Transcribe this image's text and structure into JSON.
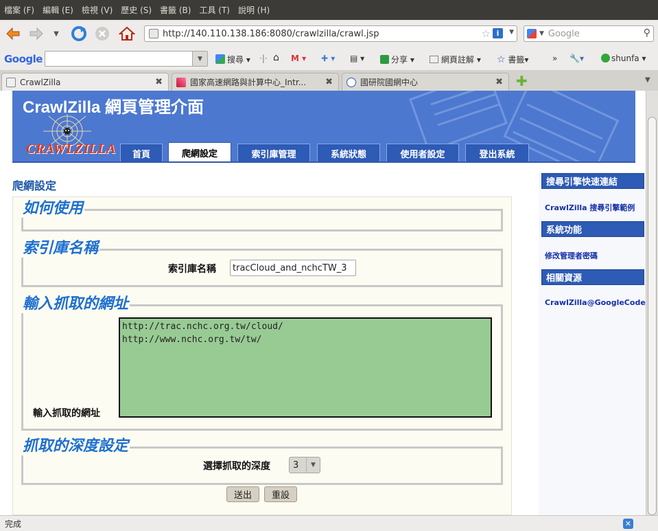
{
  "menubar": {
    "items": [
      "檔案 (F)",
      "編輯 (E)",
      "檢視 (V)",
      "歷史 (S)",
      "書籤 (B)",
      "工具 (T)",
      "說明 (H)"
    ]
  },
  "toolbar": {
    "url": "http://140.110.138.186:8080/crawlzilla/crawl.jsp",
    "search_placeholder": "Google"
  },
  "google_toolbar": {
    "logo": "Google",
    "search_label": "搜尋",
    "share_label": "分享",
    "notes_label": "網頁註解",
    "bookmarks_label": "書籤",
    "more": "»",
    "user": "shunfa"
  },
  "tabs": [
    {
      "label": "CrawlZilla",
      "active": true
    },
    {
      "label": "國家高速網路與計算中心_Intr...",
      "active": false
    },
    {
      "label": "國研院國網中心",
      "active": false
    }
  ],
  "page": {
    "banner_title": "CrawlZilla 網頁管理介面",
    "logo_text": "CRAWLZILLA",
    "nav": [
      "首頁",
      "爬網設定",
      "索引庫管理",
      "系統狀態",
      "使用者設定",
      "登出系統"
    ],
    "section_title": "爬網設定",
    "howto_legend": "如何使用",
    "index_legend": "索引庫名稱",
    "index_label": "索引庫名稱",
    "index_value": "tracCloud_and_nchcTW_3",
    "url_legend": "輸入抓取的網址",
    "url_label": "輸入抓取的網址",
    "url_value": "http://trac.nchc.org.tw/cloud/\nhttp://www.nchc.org.tw/tw/",
    "depth_legend": "抓取的深度設定",
    "depth_label": "選擇抓取的深度",
    "depth_value": "3",
    "submit_label": "送出",
    "reset_label": "重設"
  },
  "sidebar": {
    "quicklinks_title": "搜尋引擎快速連結",
    "quicklinks_item": "CrawlZilla 搜尋引擎範例",
    "functions_title": "系統功能",
    "functions_item": "修改管理者密碼",
    "resources_title": "相關資源",
    "resources_item": "CrawlZilla@GoogleCode"
  },
  "statusbar": {
    "text": "完成"
  }
}
